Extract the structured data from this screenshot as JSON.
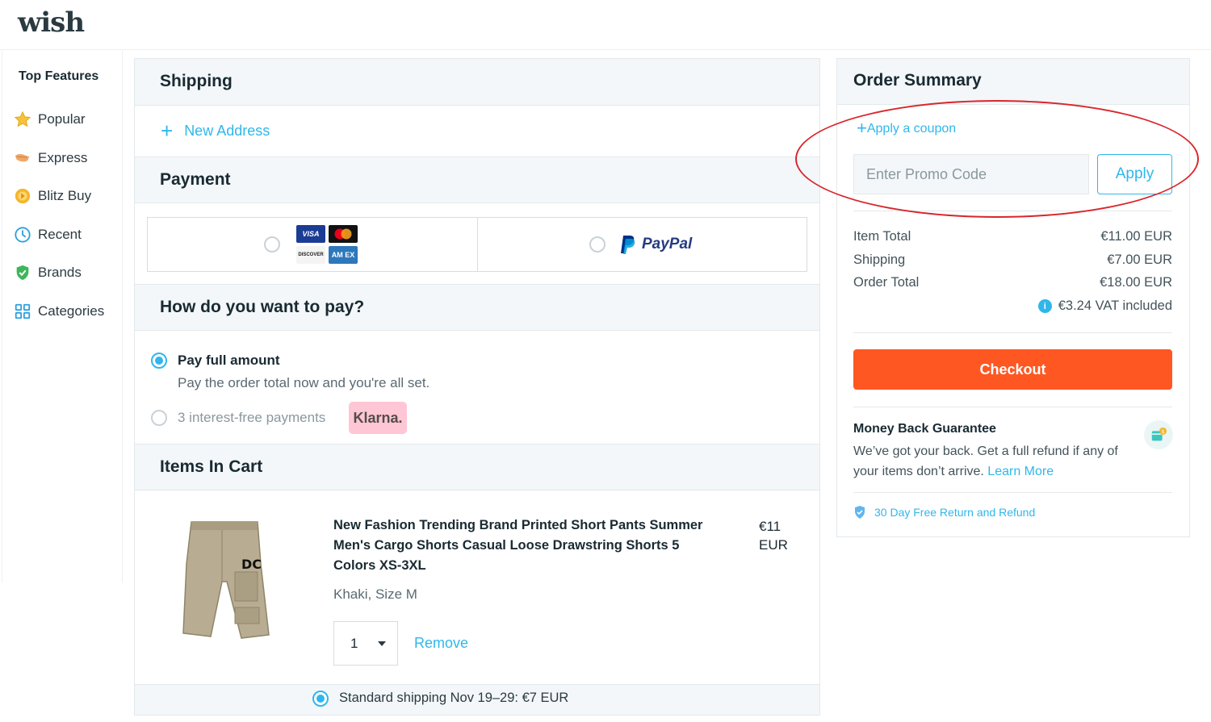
{
  "header": {
    "logo": "wish"
  },
  "sidebar": {
    "title": "Top Features",
    "items": [
      {
        "label": "Popular",
        "icon": "star-icon"
      },
      {
        "label": "Express",
        "icon": "express-icon"
      },
      {
        "label": "Blitz Buy",
        "icon": "blitz-buy-icon"
      },
      {
        "label": "Recent",
        "icon": "clock-icon"
      },
      {
        "label": "Brands",
        "icon": "shield-check-icon"
      },
      {
        "label": "Categories",
        "icon": "grid-icon"
      }
    ]
  },
  "shipping": {
    "title": "Shipping",
    "new_address": "New Address"
  },
  "payment": {
    "title": "Payment",
    "cards": {
      "visa": "VISA",
      "discover": "DISCOVER",
      "amex": "AM EX"
    },
    "paypal": "PayPal"
  },
  "pay_how": {
    "title": "How do you want to pay?",
    "full_label": "Pay full amount",
    "full_desc": "Pay the order total now and you're all set.",
    "installments_label": "3 interest-free payments",
    "klarna": "Klarna."
  },
  "cart": {
    "title": "Items In Cart",
    "item": {
      "title": "New Fashion Trending Brand Printed Short Pants Summer Men's Cargo Shorts Casual Loose Drawstring Shorts 5 Colors XS-3XL",
      "price": "€11",
      "currency": "EUR",
      "variant": "Khaki, Size M",
      "quantity": "1",
      "remove": "Remove"
    },
    "shipping_option": "Standard shipping Nov 19–29: €7 EUR"
  },
  "summary": {
    "title": "Order Summary",
    "coupon_link": "Apply a coupon",
    "promo_placeholder": "Enter Promo Code",
    "apply": "Apply",
    "item_total_label": "Item Total",
    "item_total": "€11.00 EUR",
    "shipping_label": "Shipping",
    "shipping": "€7.00 EUR",
    "order_total_label": "Order Total",
    "order_total": "€18.00 EUR",
    "vat": "€3.24 VAT included",
    "checkout": "Checkout",
    "mbg_title": "Money Back Guarantee",
    "mbg_text": "We’ve got your back. Get a full refund if any of your items don’t arrive.",
    "learn_more": "Learn More",
    "return_text": "30 Day Free Return and Refund"
  },
  "colors": {
    "accent": "#2fb7ec",
    "checkout": "#ff5722",
    "annotation": "#d9262b"
  }
}
